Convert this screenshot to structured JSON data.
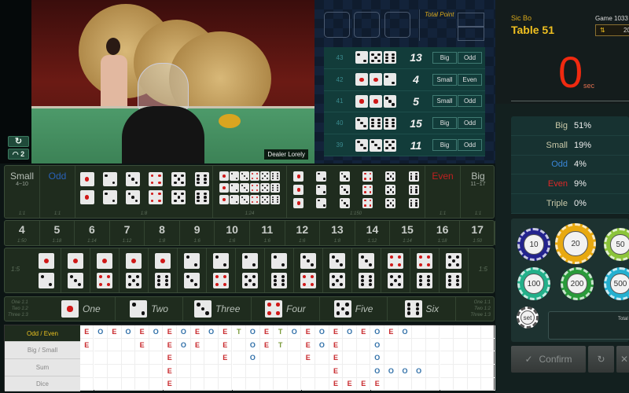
{
  "video": {
    "dealer_label": "Dealer Lorely",
    "refresh_icon": "refresh-icon",
    "signal_label": "2"
  },
  "results_panel": {
    "total_point_label": "Total Point",
    "history": [
      {
        "round": "43",
        "dice": [
          2,
          5,
          6
        ],
        "sum": "13",
        "size": "Big",
        "parity": "Odd"
      },
      {
        "round": "42",
        "dice": [
          1,
          1,
          2
        ],
        "sum": "4",
        "size": "Small",
        "parity": "Even"
      },
      {
        "round": "41",
        "dice": [
          1,
          1,
          3
        ],
        "sum": "5",
        "size": "Small",
        "parity": "Odd"
      },
      {
        "round": "40",
        "dice": [
          3,
          6,
          6
        ],
        "sum": "15",
        "size": "Big",
        "parity": "Odd"
      },
      {
        "round": "39",
        "dice": [
          3,
          3,
          5
        ],
        "sum": "11",
        "size": "Big",
        "parity": "Odd"
      }
    ]
  },
  "header": {
    "game_name": "Sic Bo",
    "table": "Table 51",
    "game_no": "Game 1033",
    "balance": "20",
    "countdown": "0",
    "countdown_unit": "sec"
  },
  "stats": [
    {
      "label": "Big",
      "value": "51%",
      "color": "#c8c8a8"
    },
    {
      "label": "Small",
      "value": "19%",
      "color": "#c8c8a8"
    },
    {
      "label": "Odd",
      "value": "4%",
      "color": "#3a86d8"
    },
    {
      "label": "Even",
      "value": "9%",
      "color": "#e02828"
    },
    {
      "label": "Triple",
      "value": "0%",
      "color": "#c8c8a8"
    }
  ],
  "chips": [
    {
      "value": "10",
      "color": "#23238e"
    },
    {
      "value": "20",
      "color": "#e8a910",
      "selected": true
    },
    {
      "value": "50",
      "color": "#8cc43a"
    },
    {
      "value": "100",
      "color": "#23b08a"
    },
    {
      "value": "200",
      "color": "#2a9a3a"
    },
    {
      "value": "500",
      "color": "#25b0d0"
    }
  ],
  "set_label": "set",
  "total_label": "Total",
  "actions": {
    "confirm": "Confirm"
  },
  "board": {
    "small": {
      "label": "Small",
      "range": "4~10",
      "odds": "1:1"
    },
    "odd": {
      "label": "Odd",
      "odds": "1:1"
    },
    "doubles_odds": "1:8",
    "any_triple_odds": "1:24",
    "triple_odds": "1:150",
    "even": {
      "label": "Even",
      "odds": "1:1"
    },
    "big": {
      "label": "Big",
      "range": "11~17",
      "odds": "1:1"
    },
    "sums": [
      {
        "n": "4",
        "odds": "1:50"
      },
      {
        "n": "5",
        "odds": "1:18"
      },
      {
        "n": "6",
        "odds": "1:14"
      },
      {
        "n": "7",
        "odds": "1:12"
      },
      {
        "n": "8",
        "odds": "1:8"
      },
      {
        "n": "9",
        "odds": "1:6"
      },
      {
        "n": "10",
        "odds": "1:6"
      },
      {
        "n": "11",
        "odds": "1:6"
      },
      {
        "n": "12",
        "odds": "1:6"
      },
      {
        "n": "13",
        "odds": "1:8"
      },
      {
        "n": "14",
        "odds": "1:12"
      },
      {
        "n": "15",
        "odds": "1:14"
      },
      {
        "n": "16",
        "odds": "1:18"
      },
      {
        "n": "17",
        "odds": "1:50"
      }
    ],
    "combo_odds": "1:5",
    "combos": [
      [
        1,
        2
      ],
      [
        1,
        3
      ],
      [
        1,
        4
      ],
      [
        1,
        5
      ],
      [
        1,
        6
      ],
      [
        2,
        3
      ],
      [
        2,
        4
      ],
      [
        2,
        5
      ],
      [
        2,
        6
      ],
      [
        3,
        4
      ],
      [
        3,
        5
      ],
      [
        3,
        6
      ],
      [
        4,
        5
      ],
      [
        4,
        6
      ],
      [
        5,
        6
      ]
    ],
    "single_odds": [
      "One 1:1",
      "Two 1:2",
      "Three 1:3"
    ],
    "singles": [
      "One",
      "Two",
      "Three",
      "Four",
      "Five",
      "Six"
    ]
  },
  "roadmap": {
    "tabs": [
      "Odd / Even",
      "Big / Small",
      "Sum",
      "Dice"
    ],
    "grid": [
      [
        "E",
        "O",
        "E",
        "O",
        "E",
        "O",
        "E",
        "O",
        "E",
        "O",
        "E",
        "T",
        "O",
        "E",
        "T",
        "O",
        "E",
        "O",
        "E",
        "O",
        "E",
        "O",
        "E",
        "O"
      ],
      [
        "E",
        "",
        "",
        "",
        "E",
        "",
        "E",
        "O",
        "E",
        "",
        "E",
        "",
        "O",
        "E",
        "T",
        "",
        "E",
        "O",
        "E",
        "",
        "",
        "O"
      ],
      [
        "",
        "",
        "",
        "",
        "",
        "",
        "E",
        "",
        "",
        "",
        "E",
        "",
        "O",
        "",
        "",
        "",
        "E",
        "",
        "E",
        "",
        "",
        "O"
      ],
      [
        "",
        "",
        "",
        "",
        "",
        "",
        "E",
        "",
        "",
        "",
        "",
        "",
        "",
        "",
        "",
        "",
        "",
        "",
        "E",
        "",
        "",
        "O",
        "O",
        "O",
        "O"
      ],
      [
        "",
        "",
        "",
        "",
        "",
        "",
        "E",
        "",
        "",
        "",
        "",
        "",
        "",
        "",
        "",
        "",
        "",
        "",
        "E",
        "E",
        "E",
        "E"
      ]
    ],
    "colors": {
      "E": "#c8282c",
      "O": "#2f6fa8",
      "T": "#7a9a3a"
    }
  }
}
